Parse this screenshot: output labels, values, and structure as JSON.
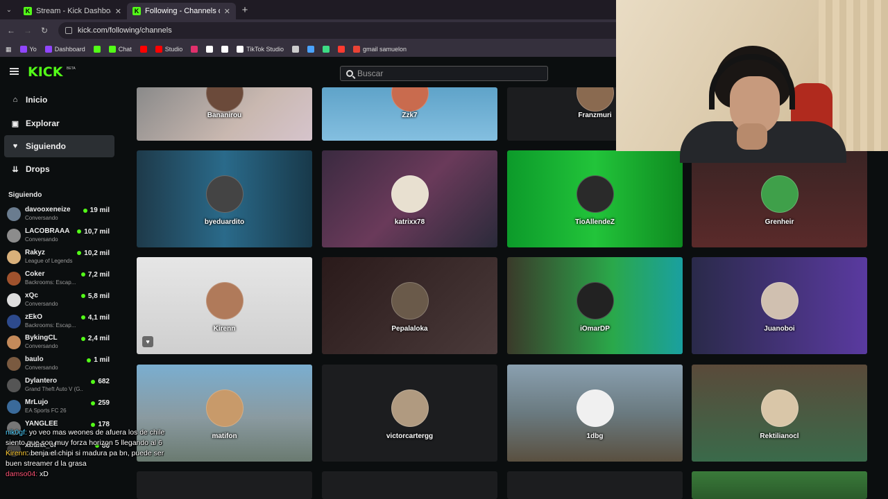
{
  "browser": {
    "tabs": [
      {
        "title": "Stream - Kick Dashboard",
        "active": false
      },
      {
        "title": "Following - Channels on Kick",
        "active": true
      }
    ],
    "url": "kick.com/following/channels",
    "bookmarks": [
      {
        "label": "Yo",
        "color": "#9146ff"
      },
      {
        "label": "Dashboard",
        "color": "#9146ff"
      },
      {
        "label": "",
        "color": "#53fc18"
      },
      {
        "label": "Chat",
        "color": "#53fc18"
      },
      {
        "label": "",
        "color": "#ff0000"
      },
      {
        "label": "Studio",
        "color": "#ff0000"
      },
      {
        "label": "",
        "color": "#e1306c"
      },
      {
        "label": "",
        "color": "#ffffff"
      },
      {
        "label": "",
        "color": "#ffffff"
      },
      {
        "label": "TikTok Studio",
        "color": "#ffffff"
      },
      {
        "label": "",
        "color": "#cccccc"
      },
      {
        "label": "",
        "color": "#4aa3ff"
      },
      {
        "label": "",
        "color": "#3ddc84"
      },
      {
        "label": "",
        "color": "#ff3b30"
      },
      {
        "label": "gmail samuelon",
        "color": "#ea4335"
      }
    ]
  },
  "kick": {
    "logo": "KICK",
    "beta": "BETA",
    "search_placeholder": "Buscar",
    "nav": [
      {
        "label": "Inicio",
        "icon": "home-icon",
        "glyph": "⌂",
        "active": false
      },
      {
        "label": "Explorar",
        "icon": "compass-icon",
        "glyph": "▣",
        "active": false
      },
      {
        "label": "Siguiendo",
        "icon": "heart-icon",
        "glyph": "♥",
        "active": true
      },
      {
        "label": "Drops",
        "icon": "drops-icon",
        "glyph": "⇊",
        "active": false
      }
    ],
    "following_title": "Siguiendo",
    "following": [
      {
        "name": "davooxeneize",
        "category": "Conversando",
        "viewers": "19 mil",
        "color": "#6a7c8f"
      },
      {
        "name": "LACOBRAAA",
        "category": "Conversando",
        "viewers": "10,7 mil",
        "color": "#8c8c8c"
      },
      {
        "name": "Rakyz",
        "category": "League of Legends",
        "viewers": "10,2 mil",
        "color": "#d9b07a"
      },
      {
        "name": "Coker",
        "category": "Backrooms: Escap...",
        "viewers": "7,2 mil",
        "color": "#a0522d"
      },
      {
        "name": "xQc",
        "category": "Conversando",
        "viewers": "5,8 mil",
        "color": "#dddddd"
      },
      {
        "name": "zEkO",
        "category": "Backrooms: Escap...",
        "viewers": "4,1 mil",
        "color": "#2d4a8c"
      },
      {
        "name": "BykingCL",
        "category": "Conversando",
        "viewers": "2,4 mil",
        "color": "#c48a5a"
      },
      {
        "name": "baulo",
        "category": "Conversando",
        "viewers": "1 mil",
        "color": "#7a5a40"
      },
      {
        "name": "Dylantero",
        "category": "Grand Theft Auto V (G...",
        "viewers": "682",
        "color": "#555555"
      },
      {
        "name": "MrLujo",
        "category": "EA Sports FC 26",
        "viewers": "259",
        "color": "#3a6a9a"
      },
      {
        "name": "YANGLEE",
        "category": "",
        "viewers": "178",
        "color": "#777777"
      },
      {
        "name": "xDanx_of",
        "category": "Conversando",
        "viewers": "86",
        "color": "#444444"
      }
    ],
    "channels": [
      {
        "name": "Bananirou"
      },
      {
        "name": "Zzk7"
      },
      {
        "name": "Franzmuri"
      },
      {
        "name": "byeduardito"
      },
      {
        "name": "katrixx78"
      },
      {
        "name": "TioAllendeZ"
      },
      {
        "name": "Grenheir"
      },
      {
        "name": "Kirenn"
      },
      {
        "name": "Pepalaloka"
      },
      {
        "name": "iOmarDP"
      },
      {
        "name": "Juanoboi"
      },
      {
        "name": "matifon"
      },
      {
        "name": "victorcartergg"
      },
      {
        "name": "1dbg"
      },
      {
        "name": "Rektilianocl"
      }
    ]
  },
  "chat": [
    {
      "user": "nik0gf:",
      "text": " yo veo mas weones de afuera los de chile siento que son muy forza horizon 5 llegando al 6",
      "color": "#4dd0ff"
    },
    {
      "user": "Kirenn:",
      "text": " benja el chipi si madura pa bn, puede ser buen streamer d la grasa",
      "color": "#ffcc33"
    },
    {
      "user": "damso04:",
      "text": " xD",
      "color": "#ff5577"
    }
  ]
}
